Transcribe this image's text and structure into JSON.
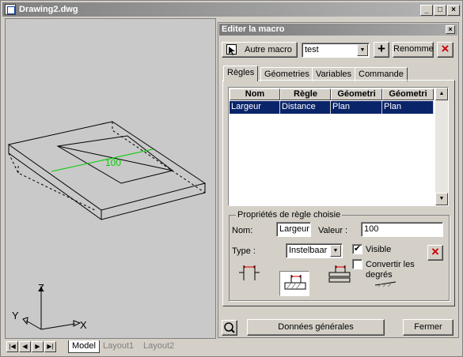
{
  "window": {
    "title": "Drawing2.dwg",
    "controls": {
      "minimize": "_",
      "maximize": "□",
      "close": "×"
    }
  },
  "canvas": {
    "dimension_text": "100",
    "axis_labels": {
      "z": "Z",
      "y": "Y",
      "x": "X"
    }
  },
  "layout_tabs": {
    "nav": [
      "|◀",
      "◀",
      "▶",
      "▶|"
    ],
    "tabs": [
      "Model",
      "Layout1",
      "Layout2"
    ],
    "active": "Model"
  },
  "dialog": {
    "title": "Editer la macro",
    "close": "×",
    "toolbar": {
      "other_macro_label": "Autre macro",
      "macro_select_value": "test",
      "add_label": "+",
      "rename_label": "Renomme",
      "delete_label": "×"
    },
    "tabs": [
      "Règles",
      "Géometries",
      "Variables",
      "Commande"
    ],
    "active_tab": "Règles",
    "rules_table": {
      "columns": [
        "Nom",
        "Règle",
        "Géometri",
        "Géometri"
      ],
      "rows": [
        [
          "Largeur",
          "Distance",
          "Plan",
          "Plan"
        ]
      ]
    },
    "properties": {
      "legend": "Propriétés de règle choisie",
      "name_label": "Nom:",
      "name_value": "Largeur",
      "value_label": "Valeur :",
      "value_value": "100",
      "type_label": "Type :",
      "type_value": "Instelbaar b",
      "visible_label": "Visible",
      "visible_checked": true,
      "convert_label_1": "Convertir les",
      "convert_label_2": "degrés",
      "convert_checked": false,
      "delete_label": "×"
    },
    "footer": {
      "general_data_label": "Données générales",
      "close_label": "Fermer"
    }
  },
  "colors": {
    "selection": "#0a246a",
    "accent_red": "#cc0000",
    "dimension_green": "#00cc00"
  }
}
